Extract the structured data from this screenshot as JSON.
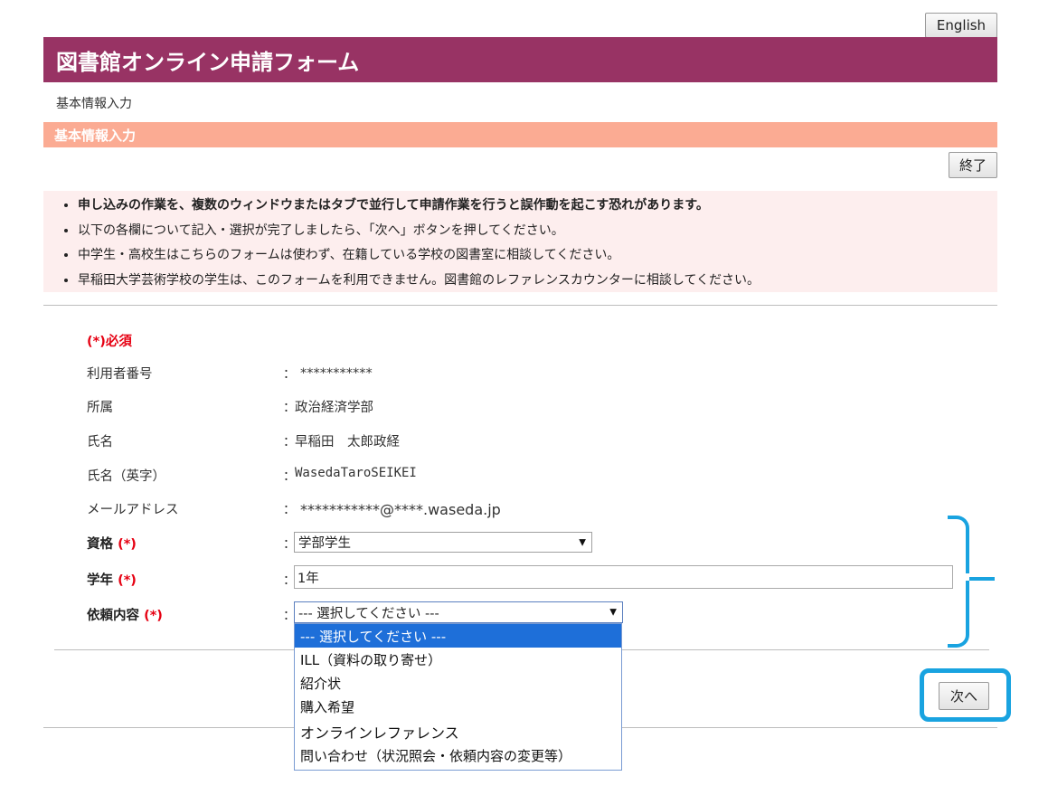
{
  "header": {
    "lang_button": "English",
    "title": "図書館オンライン申請フォーム",
    "breadcrumb": "基本情報入力",
    "section_title": "基本情報入力",
    "end_button": "終了"
  },
  "notices": [
    "申し込みの作業を、複数のウィンドウまたはタブで並行して申請作業を行うと誤作動を起こす恐れがあります。",
    "以下の各欄について記入・選択が完了しましたら、「次へ」ボタンを押してください。",
    "中学生・高校生はこちらのフォームは使わず、在籍している学校の図書室に相談してください。",
    "早稲田大学芸術学校の学生は、このフォームを利用できません。図書館のレファレンスカウンターに相談してください。"
  ],
  "form": {
    "required_note": "(*)必須",
    "required_mark": "(*)",
    "colon": "：",
    "user_number_label": "利用者番号",
    "user_number_value": "***********",
    "affiliation_label": "所属",
    "affiliation_value": "政治経済学部",
    "name_label": "氏名",
    "name_value": "早稲田　太郎政経",
    "name_en_label": "氏名（英字）",
    "name_en_value": "WasedaTaroSEIKEI",
    "email_label": "メールアドレス",
    "email_value": "***********@****.waseda.jp",
    "status_label": "資格",
    "status_value": "学部学生",
    "year_label": "学年",
    "year_value": "1年",
    "request_label": "依頼内容",
    "request_value": "--- 選択してください ---",
    "request_options": [
      "--- 選択してください ---",
      "ILL（資料の取り寄せ）",
      "紹介状",
      "購入希望",
      "オンラインレファレンス",
      "問い合わせ（状況照会・依頼内容の変更等）"
    ]
  },
  "footer": {
    "next_button": "次へ"
  },
  "colors": {
    "title_bar": "#983364",
    "section_bar": "#fbab93",
    "notice_bg": "#fdeeee",
    "required": "#e60012",
    "highlight": "#19a3e0",
    "selected_option": "#1e6fd9"
  }
}
